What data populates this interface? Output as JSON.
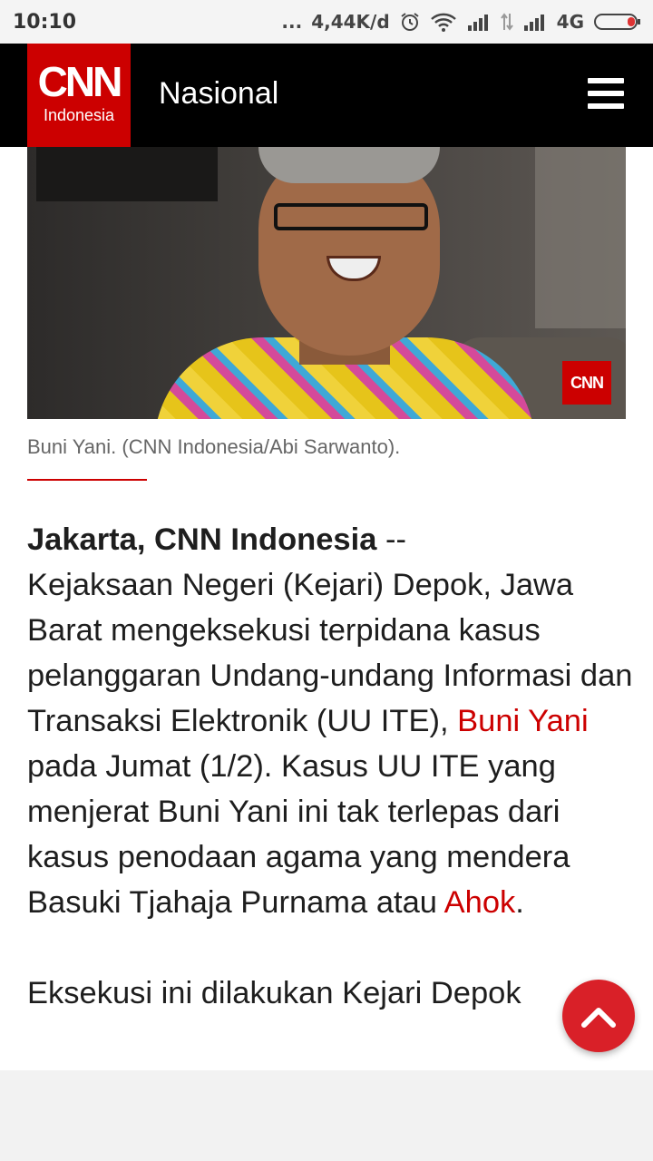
{
  "status_bar": {
    "time": "10:10",
    "dots": "...",
    "speed": "4,44K/d",
    "network": "4G",
    "icons": [
      "alarm-icon",
      "wifi-icon",
      "signal-icon",
      "data-arrows-icon",
      "signal-icon",
      "battery-icon"
    ]
  },
  "header": {
    "logo_main": "CNN",
    "logo_sub": "Indonesia",
    "section": "Nasional",
    "menu_icon": "hamburger-menu-icon"
  },
  "photo": {
    "badge": "CNN",
    "caption": "Buni Yani. (CNN Indonesia/Abi Sarwanto)."
  },
  "article": {
    "dateline": "Jakarta, CNN Indonesia",
    "dash": " --",
    "p1_a": "Kejaksaan Negeri (Kejari) Depok, Jawa Barat mengeksekusi terpidana kasus pelanggaran Undang-undang Informasi dan Transaksi Elektronik (UU ITE), ",
    "link1": "Buni Yani",
    "p1_b": " pada  Jumat (1/2). Kasus UU ITE yang menjerat Buni Yani ini tak terlepas dari kasus penodaan agama yang mendera Basuki Tjahaja Purnama atau ",
    "link2": "Ahok",
    "p1_c": ".",
    "p2": "Eksekusi ini dilakukan Kejari Depok"
  },
  "colors": {
    "brand_red": "#cc0000",
    "header_bg": "#000000",
    "fab_red": "#d92028"
  }
}
